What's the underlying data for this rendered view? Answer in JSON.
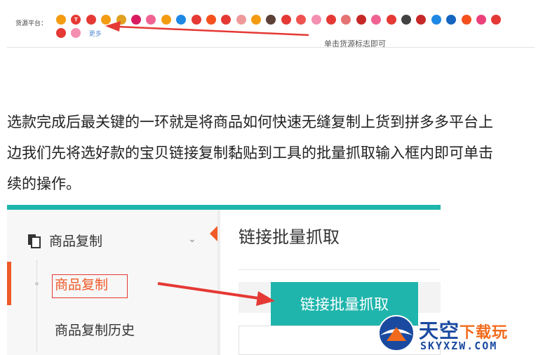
{
  "source_strip": {
    "label": "货源平台：",
    "more_label": "更多",
    "hint": "单击货源标志即可",
    "icons_row1": [
      {
        "name": "source-logo-1",
        "color": "#f39c12",
        "glyph": ""
      },
      {
        "name": "source-logo-t",
        "color": "#e53935",
        "glyph": "T"
      },
      {
        "name": "source-logo-3",
        "color": "#e53935",
        "glyph": ""
      },
      {
        "name": "source-logo-4",
        "color": "#f39c12",
        "glyph": ""
      },
      {
        "name": "source-logo-5",
        "color": "#e0a020",
        "glyph": ""
      },
      {
        "name": "source-logo-6",
        "color": "#d81b60",
        "glyph": ""
      },
      {
        "name": "source-logo-7",
        "color": "#f06292",
        "glyph": ""
      },
      {
        "name": "source-logo-8",
        "color": "#f39c12",
        "glyph": ""
      },
      {
        "name": "source-logo-9",
        "color": "#1e88e5",
        "glyph": ""
      },
      {
        "name": "source-logo-10",
        "color": "#e53935",
        "glyph": ""
      },
      {
        "name": "source-logo-11",
        "color": "#f4511e",
        "glyph": ""
      },
      {
        "name": "source-logo-12",
        "color": "#e53935",
        "glyph": ""
      },
      {
        "name": "source-logo-13",
        "color": "#ef9a9a",
        "glyph": ""
      },
      {
        "name": "source-logo-14",
        "color": "#f39c12",
        "glyph": ""
      },
      {
        "name": "source-logo-15",
        "color": "#5d4037",
        "glyph": ""
      },
      {
        "name": "source-logo-16",
        "color": "#e53935",
        "glyph": ""
      },
      {
        "name": "source-logo-17",
        "color": "#ef5350",
        "glyph": ""
      },
      {
        "name": "source-logo-18",
        "color": "#f48fb1",
        "glyph": ""
      },
      {
        "name": "source-logo-19",
        "color": "#e53935",
        "glyph": ""
      },
      {
        "name": "source-logo-20",
        "color": "#e57373",
        "glyph": ""
      },
      {
        "name": "source-logo-21",
        "color": "#c62828",
        "glyph": ""
      },
      {
        "name": "source-logo-22",
        "color": "#f06292",
        "glyph": ""
      },
      {
        "name": "source-logo-23",
        "color": "#e53935",
        "glyph": ""
      },
      {
        "name": "source-logo-24",
        "color": "#424242",
        "glyph": ""
      },
      {
        "name": "source-logo-25",
        "color": "#c62828",
        "glyph": ""
      },
      {
        "name": "source-logo-26",
        "color": "#1e88e5",
        "glyph": ""
      },
      {
        "name": "source-logo-27",
        "color": "#1565c0",
        "glyph": ""
      },
      {
        "name": "source-logo-28",
        "color": "#f4511e",
        "glyph": ""
      },
      {
        "name": "source-logo-29",
        "color": "#ec407a",
        "glyph": ""
      },
      {
        "name": "source-logo-30",
        "color": "#e53935",
        "glyph": ""
      }
    ],
    "icons_row2": [
      {
        "name": "source-logo-31",
        "color": "#e53935",
        "glyph": ""
      },
      {
        "name": "source-logo-32",
        "color": "#f48fb1",
        "glyph": ""
      }
    ]
  },
  "article": {
    "line1": "选款完成后最关键的一环就是将商品如何快速无缝复制上货到拼多多平台上",
    "line2": "边我们先将选好款的宝贝链接复制黏贴到工具的批量抓取输入框内即可单击",
    "line3": "续的操作。"
  },
  "tool": {
    "menu_head": "商品复制",
    "menu_item_active": "商品复制",
    "menu_item_history": "商品复制历史",
    "main_title": "链接批量抓取",
    "fetch_button": "链接批量抓取",
    "accent_color": "#1fb5ac",
    "active_color": "#f05a28"
  },
  "watermark": {
    "title_main": "天空",
    "title_accent": "下载玩",
    "domain": "SKYXZW.COM"
  }
}
